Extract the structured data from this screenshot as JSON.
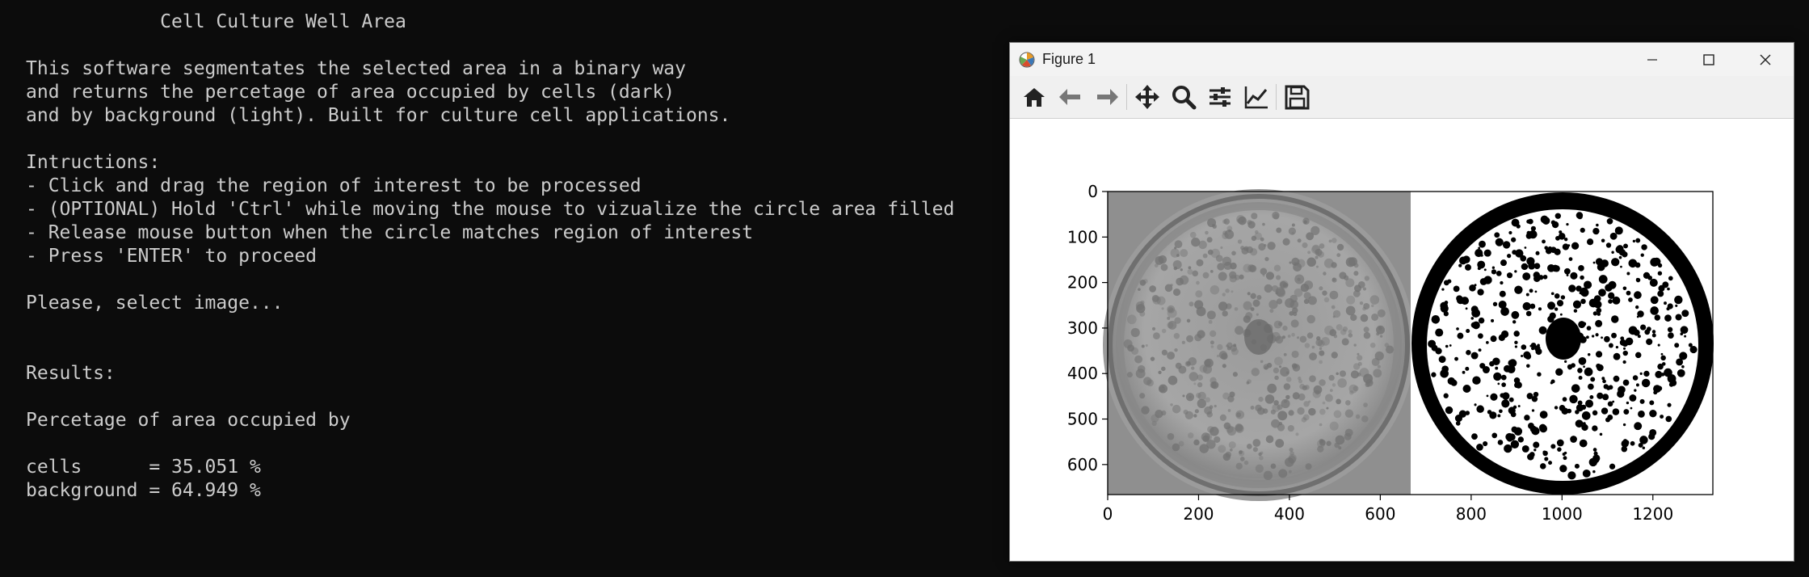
{
  "terminal": {
    "lines": [
      "            Cell Culture Well Area",
      "",
      "This software segmentates the selected area in a binary way",
      "and returns the percetage of area occupied by cells (dark)",
      "and by background (light). Built for culture cell applications.",
      "",
      "Intructions:",
      "- Click and drag the region of interest to be processed",
      "- (OPTIONAL) Hold 'Ctrl' while moving the mouse to vizualize the circle area filled",
      "- Release mouse button when the circle matches region of interest",
      "- Press 'ENTER' to proceed",
      "",
      "Please, select image...",
      "",
      "",
      "Results:",
      "",
      "Percetage of area occupied by",
      "",
      "cells      = 35.051 %",
      "background = 64.949 %"
    ]
  },
  "window": {
    "title": "Figure 1",
    "controls": [
      "minimize-icon",
      "maximize-icon",
      "close-icon"
    ]
  },
  "toolbar": {
    "buttons": [
      "home-icon",
      "back-arrow-icon",
      "forward-arrow-icon",
      "pan-move-icon",
      "zoom-magnifier-icon",
      "subplots-configure-icon",
      "edit-axis-icon",
      "save-icon"
    ]
  },
  "chart_data": {
    "type": "image",
    "x_ticks": [
      0,
      200,
      400,
      600,
      800,
      1000,
      1200
    ],
    "y_ticks": [
      0,
      100,
      200,
      300,
      400,
      500,
      600
    ],
    "xlim": [
      0,
      1332
    ],
    "ylim": [
      666,
      0
    ],
    "panels": [
      {
        "content": "grayscale-well-photo",
        "x_range": [
          0,
          666
        ]
      },
      {
        "content": "binary-segmentation",
        "x_range": [
          666,
          1332
        ]
      }
    ],
    "colors": {
      "cells": "#000000",
      "background": "#ffffff"
    }
  }
}
